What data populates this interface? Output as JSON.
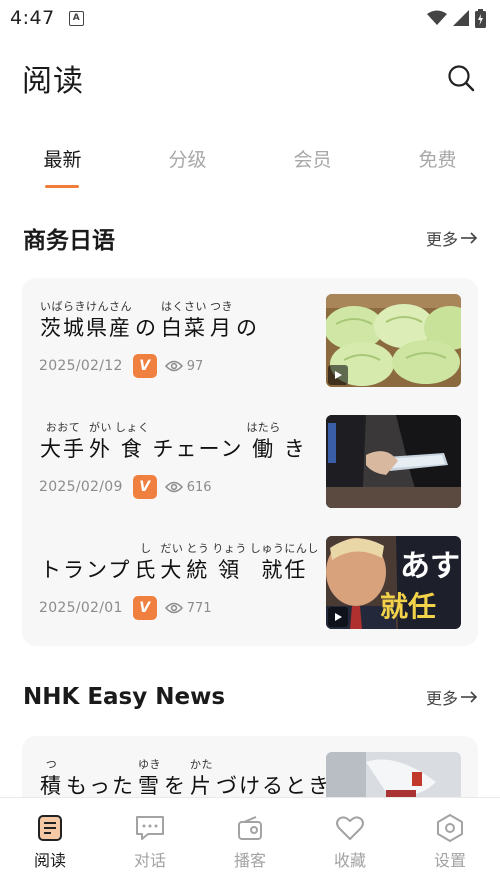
{
  "status_bar": {
    "time": "4:47",
    "notification_glyph": "A"
  },
  "header": {
    "title": "阅读"
  },
  "tabs": [
    {
      "label": "最新",
      "active": true
    },
    {
      "label": "分级",
      "active": false
    },
    {
      "label": "会员",
      "active": false
    },
    {
      "label": "免费",
      "active": false
    }
  ],
  "sections": {
    "business": {
      "title": "商务日语",
      "more_label": "更多",
      "articles": [
        {
          "ruby": [
            {
              "rt": "いばらきけんさん",
              "base": "茨城県産"
            },
            {
              "rt": "",
              "base": "の"
            },
            {
              "rt": "はくさい",
              "base": "白菜"
            },
            {
              "rt": "つき",
              "base": "月"
            },
            {
              "rt": "",
              "base": "の"
            }
          ],
          "date": "2025/02/12",
          "vip_label": "V",
          "views": "97",
          "thumb_icon": "cabbage-photo"
        },
        {
          "ruby": [
            {
              "rt": "おおて",
              "base": "大手"
            },
            {
              "rt": "がい",
              "base": "外"
            },
            {
              "rt": "しょく",
              "base": "食"
            },
            {
              "rt": "",
              "base": "チェーン"
            },
            {
              "rt": "はたら",
              "base": "働"
            },
            {
              "rt": "",
              "base": "き"
            }
          ],
          "date": "2025/02/09",
          "vip_label": "V",
          "views": "616",
          "thumb_icon": "tablet-order-photo"
        },
        {
          "ruby": [
            {
              "rt": "",
              "base": "トランプ"
            },
            {
              "rt": "し",
              "base": "氏"
            },
            {
              "rt": "だい",
              "base": "大"
            },
            {
              "rt": "とう",
              "base": "統"
            },
            {
              "rt": "りょう",
              "base": "領"
            },
            {
              "rt": "しゅうにんし",
              "base": "就任"
            }
          ],
          "date": "2025/02/01",
          "vip_label": "V",
          "views": "771",
          "thumb_icon": "news-portrait-photo",
          "thumb_text": [
            "あす",
            "就任"
          ]
        }
      ]
    },
    "nhk": {
      "title": "NHK Easy News",
      "more_label": "更多",
      "articles": [
        {
          "ruby": [
            {
              "rt": "つ",
              "base": "積"
            },
            {
              "rt": "",
              "base": "もった"
            },
            {
              "rt": "ゆき",
              "base": "雪"
            },
            {
              "rt": "",
              "base": "を"
            },
            {
              "rt": "かた",
              "base": "片"
            },
            {
              "rt": "",
              "base": "づけるとき"
            }
          ],
          "thumb_icon": "snow-clearing-photo"
        }
      ]
    }
  },
  "bottom_nav": [
    {
      "label": "阅读",
      "icon": "document-icon",
      "active": true
    },
    {
      "label": "对话",
      "icon": "chat-icon",
      "active": false
    },
    {
      "label": "播客",
      "icon": "podcast-icon",
      "active": false
    },
    {
      "label": "收藏",
      "icon": "heart-icon",
      "active": false
    },
    {
      "label": "设置",
      "icon": "settings-icon",
      "active": false
    }
  ],
  "colors": {
    "accent": "#f07d3a",
    "card_bg": "#f7f7f7",
    "muted_text": "#8c8c8c"
  }
}
